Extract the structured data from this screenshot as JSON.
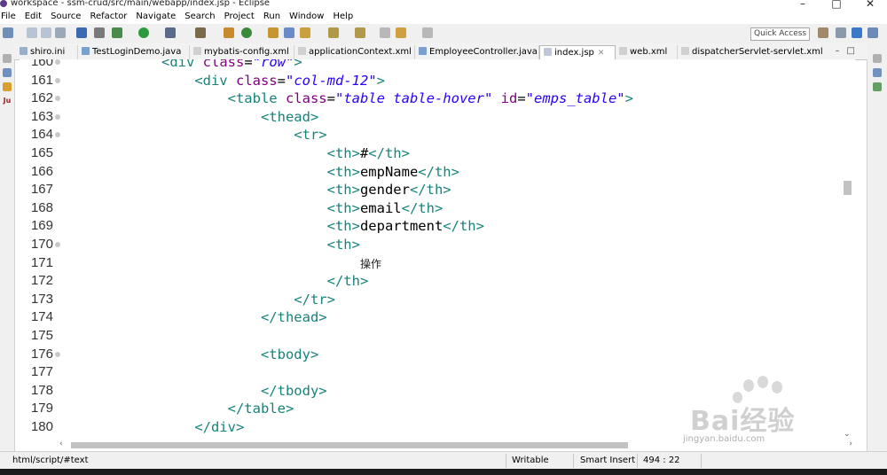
{
  "window": {
    "title": "workspace - ssm-crud/src/main/webapp/index.jsp - Eclipse",
    "controls": [
      "–",
      "□",
      "✕"
    ]
  },
  "menu": [
    "File",
    "Edit",
    "Source",
    "Refactor",
    "Navigate",
    "Search",
    "Project",
    "Run",
    "Window",
    "Help"
  ],
  "toolbar": {
    "quick_access_placeholder": "Quick Access"
  },
  "tabs": [
    {
      "label": "shiro.ini",
      "icon": "ini-file-icon",
      "active": false
    },
    {
      "label": "TestLoginDemo.java",
      "icon": "java-file-icon",
      "active": false
    },
    {
      "label": "mybatis-config.xml",
      "icon": "xml-file-icon",
      "active": false
    },
    {
      "label": "applicationContext.xml",
      "icon": "xml-file-icon",
      "active": false
    },
    {
      "label": "EmployeeController.java",
      "icon": "java-file-icon",
      "active": false
    },
    {
      "label": "index.jsp",
      "icon": "jsp-file-icon",
      "active": true
    },
    {
      "label": "web.xml",
      "icon": "xml-file-icon",
      "active": false
    },
    {
      "label": "dispatcherServlet-servlet.xml",
      "icon": "xml-file-icon",
      "active": false
    }
  ],
  "editor": {
    "lines": [
      {
        "num": "160",
        "fold": true,
        "indent": "            ",
        "parts": [
          {
            "t": "<div ",
            "c": "tag"
          },
          {
            "t": "class",
            "c": "attr"
          },
          {
            "t": "=",
            "c": "txt"
          },
          {
            "t": "\"row\"",
            "c": "str"
          },
          {
            "t": ">",
            "c": "tag"
          }
        ]
      },
      {
        "num": "161",
        "fold": true,
        "indent": "                ",
        "parts": [
          {
            "t": "<div ",
            "c": "tag"
          },
          {
            "t": "class",
            "c": "attr"
          },
          {
            "t": "=",
            "c": "txt"
          },
          {
            "t": "\"col-md-12\"",
            "c": "str"
          },
          {
            "t": ">",
            "c": "tag"
          }
        ]
      },
      {
        "num": "162",
        "fold": true,
        "indent": "                    ",
        "parts": [
          {
            "t": "<table ",
            "c": "tag"
          },
          {
            "t": "class",
            "c": "attr"
          },
          {
            "t": "=",
            "c": "txt"
          },
          {
            "t": "\"table table-hover\"",
            "c": "str"
          },
          {
            "t": " ",
            "c": "txt"
          },
          {
            "t": "id",
            "c": "attr"
          },
          {
            "t": "=",
            "c": "txt"
          },
          {
            "t": "\"emps_table\"",
            "c": "str"
          },
          {
            "t": ">",
            "c": "tag"
          }
        ]
      },
      {
        "num": "163",
        "fold": true,
        "indent": "                        ",
        "parts": [
          {
            "t": "<thead>",
            "c": "tag"
          }
        ]
      },
      {
        "num": "164",
        "fold": true,
        "indent": "                            ",
        "parts": [
          {
            "t": "<tr>",
            "c": "tag"
          }
        ]
      },
      {
        "num": "165",
        "fold": false,
        "indent": "                                ",
        "parts": [
          {
            "t": "<th>",
            "c": "tag"
          },
          {
            "t": "#",
            "c": "txt"
          },
          {
            "t": "</th>",
            "c": "tag"
          }
        ]
      },
      {
        "num": "166",
        "fold": false,
        "indent": "                                ",
        "parts": [
          {
            "t": "<th>",
            "c": "tag"
          },
          {
            "t": "empName",
            "c": "txt"
          },
          {
            "t": "</th>",
            "c": "tag"
          }
        ]
      },
      {
        "num": "167",
        "fold": false,
        "indent": "                                ",
        "parts": [
          {
            "t": "<th>",
            "c": "tag"
          },
          {
            "t": "gender",
            "c": "txt"
          },
          {
            "t": "</th>",
            "c": "tag"
          }
        ]
      },
      {
        "num": "168",
        "fold": false,
        "indent": "                                ",
        "parts": [
          {
            "t": "<th>",
            "c": "tag"
          },
          {
            "t": "email",
            "c": "txt"
          },
          {
            "t": "</th>",
            "c": "tag"
          }
        ]
      },
      {
        "num": "169",
        "fold": false,
        "indent": "                                ",
        "parts": [
          {
            "t": "<th>",
            "c": "tag"
          },
          {
            "t": "department",
            "c": "txt"
          },
          {
            "t": "</th>",
            "c": "tag"
          }
        ]
      },
      {
        "num": "170",
        "fold": true,
        "indent": "                                ",
        "parts": [
          {
            "t": "<th>",
            "c": "tag"
          }
        ]
      },
      {
        "num": "171",
        "fold": false,
        "indent": "                                    ",
        "parts": [
          {
            "t": "操作",
            "c": "cjk"
          }
        ]
      },
      {
        "num": "172",
        "fold": false,
        "indent": "                                ",
        "parts": [
          {
            "t": "</th>",
            "c": "tag"
          }
        ]
      },
      {
        "num": "173",
        "fold": false,
        "indent": "                            ",
        "parts": [
          {
            "t": "</tr>",
            "c": "tag"
          }
        ]
      },
      {
        "num": "174",
        "fold": false,
        "indent": "                        ",
        "parts": [
          {
            "t": "</thead>",
            "c": "tag"
          }
        ]
      },
      {
        "num": "175",
        "fold": false,
        "indent": "",
        "parts": []
      },
      {
        "num": "176",
        "fold": true,
        "indent": "                        ",
        "parts": [
          {
            "t": "<tbody>",
            "c": "tag"
          }
        ]
      },
      {
        "num": "177",
        "fold": false,
        "indent": "",
        "parts": []
      },
      {
        "num": "178",
        "fold": false,
        "indent": "                        ",
        "parts": [
          {
            "t": "</tbody>",
            "c": "tag"
          }
        ]
      },
      {
        "num": "179",
        "fold": false,
        "indent": "                    ",
        "parts": [
          {
            "t": "</table>",
            "c": "tag"
          }
        ]
      },
      {
        "num": "180",
        "fold": false,
        "indent": "                ",
        "parts": [
          {
            "t": "</div>",
            "c": "tag"
          }
        ]
      }
    ]
  },
  "status": {
    "path": "html/script/#text",
    "mode": "Writable",
    "insert": "Smart Insert",
    "position": "494 : 22"
  },
  "watermark": {
    "text": "Bai经验",
    "sub": "jingyan.baidu.com"
  },
  "colors": {
    "tag": "#17837a",
    "attribute": "#7f007f",
    "string": "#2a00ff"
  }
}
